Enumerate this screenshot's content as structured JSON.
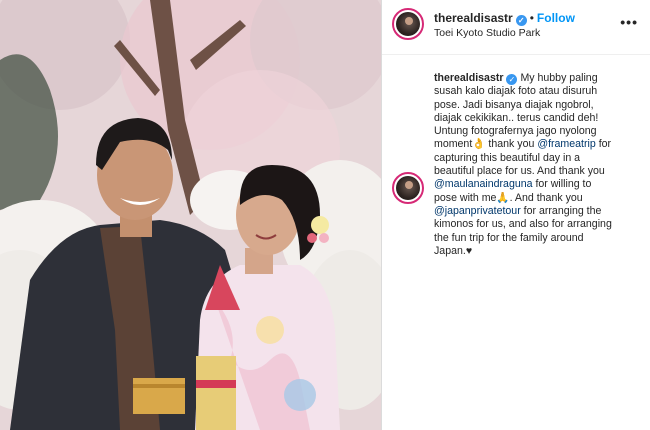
{
  "header": {
    "username": "therealdisastr",
    "verified_badge": "✓",
    "separator": "•",
    "follow_label": "Follow",
    "location": "Toei Kyoto Studio Park",
    "more_icon": "•••"
  },
  "caption": {
    "username": "therealdisastr",
    "lines": {
      "l1": "My hubby paling",
      "l2": "susah kalo diajak foto atau disuruh",
      "l3": "pose. Jadi bisanya diajak ngobrol,",
      "l4": "diajak cekikikan.. terus candid deh!",
      "l5": "Untung fotografernya jago nyolong",
      "l6a": "moment",
      "l6b": " thank you ",
      "l6m": "@frameatrip",
      "l6c": " for",
      "l7": "capturing this beautiful day in a",
      "l8": "beautiful place for us. And thank you",
      "l9m": "@maulanaindraguna",
      "l9b": " for willing to",
      "l10a": "pose with me",
      "l10b": ". And thank you",
      "l11m": "@japanprivatetour",
      "l11b": " for arranging the",
      "l12": "kimonos for us, and also for arranging",
      "l13": "the fun trip for the family around",
      "l14": "Japan.",
      "emoji_ok": "👌",
      "emoji_pray": "🙏",
      "emoji_heart": "♥"
    }
  },
  "colors": {
    "link": "#00376b",
    "follow": "#0095f6",
    "story_ring": "#d62976",
    "verified": "#3897f0"
  }
}
